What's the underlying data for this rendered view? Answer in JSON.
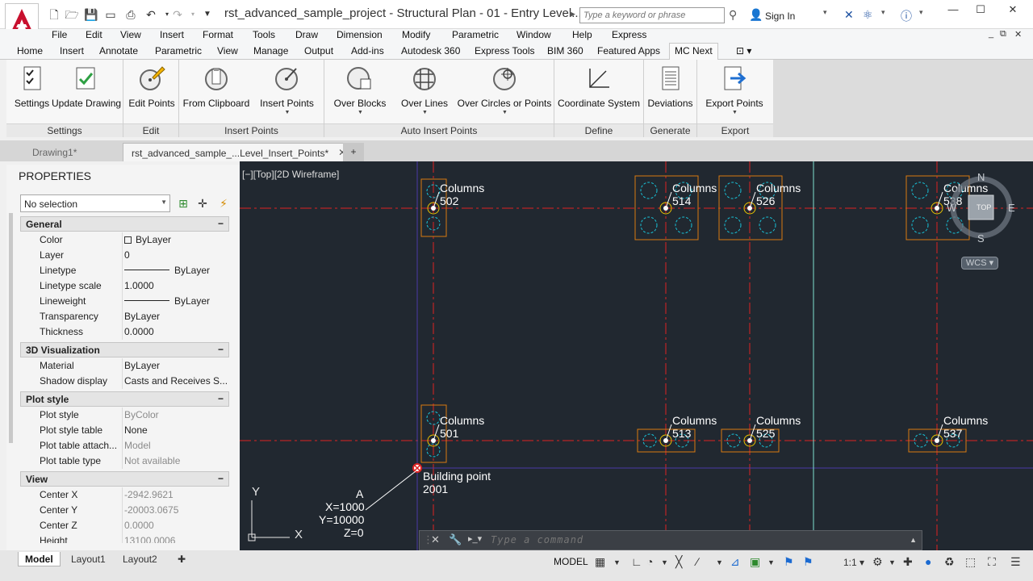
{
  "title_bar": {
    "window_title": "rst_advanced_sample_project - Structural Plan - 01 - Entry Level...",
    "search_placeholder": "Type a keyword or phrase",
    "sign_in": "Sign In"
  },
  "menu": [
    "File",
    "Edit",
    "View",
    "Insert",
    "Format",
    "Tools",
    "Draw",
    "Dimension",
    "Modify",
    "Parametric",
    "Window",
    "Help",
    "Express"
  ],
  "ribbon_tabs": [
    "Home",
    "Insert",
    "Annotate",
    "Parametric",
    "View",
    "Manage",
    "Output",
    "Add-ins",
    "Autodesk 360",
    "Express Tools",
    "BIM 360",
    "Featured Apps",
    "MC Next"
  ],
  "ribbon": {
    "buttons": {
      "settings": "Settings",
      "update_drawing": "Update Drawing",
      "edit_points": "Edit Points",
      "from_clipboard": "From Clipboard",
      "insert_points": "Insert Points",
      "over_blocks": "Over Blocks",
      "over_lines": "Over Lines",
      "over_circles": "Over Circles or Points",
      "coordinate_system": "Coordinate System",
      "deviations": "Deviations",
      "export_points": "Export Points"
    },
    "groups": {
      "settings": "Settings",
      "edit": "Edit",
      "insert_points": "Insert Points",
      "auto_insert": "Auto Insert Points",
      "define": "Define",
      "generate": "Generate",
      "export": "Export"
    }
  },
  "doc_tabs": [
    "Drawing1*",
    "rst_advanced_sample_...Level_Insert_Points*"
  ],
  "properties": {
    "title": "PROPERTIES",
    "selection": "No selection",
    "categories": {
      "general": {
        "label": "General",
        "rows": [
          {
            "k": "Color",
            "v": "ByLayer"
          },
          {
            "k": "Layer",
            "v": "0"
          },
          {
            "k": "Linetype",
            "v": "ByLayer"
          },
          {
            "k": "Linetype scale",
            "v": "1.0000"
          },
          {
            "k": "Lineweight",
            "v": "ByLayer"
          },
          {
            "k": "Transparency",
            "v": "ByLayer"
          },
          {
            "k": "Thickness",
            "v": "0.0000"
          }
        ]
      },
      "visual3d": {
        "label": "3D Visualization",
        "rows": [
          {
            "k": "Material",
            "v": "ByLayer"
          },
          {
            "k": "Shadow display",
            "v": "Casts and Receives S..."
          }
        ]
      },
      "plot": {
        "label": "Plot style",
        "rows": [
          {
            "k": "Plot style",
            "v": "ByColor"
          },
          {
            "k": "Plot style table",
            "v": "None"
          },
          {
            "k": "Plot table attach...",
            "v": "Model"
          },
          {
            "k": "Plot table type",
            "v": "Not available"
          }
        ]
      },
      "view": {
        "label": "View",
        "rows": [
          {
            "k": "Center X",
            "v": "-2942.9621"
          },
          {
            "k": "Center Y",
            "v": "-20003.0675"
          },
          {
            "k": "Center Z",
            "v": "0.0000"
          },
          {
            "k": "Height",
            "v": "13100.0006"
          }
        ]
      }
    },
    "toggle_symbol": "−"
  },
  "layout_tabs": [
    "Model",
    "Layout1",
    "Layout2"
  ],
  "drawing": {
    "view_label": "[−][Top][2D Wireframe]",
    "columns": [
      {
        "label": "Columns",
        "num": "502"
      },
      {
        "label": "Columns",
        "num": "514"
      },
      {
        "label": "Columns",
        "num": "526"
      },
      {
        "label": "Columns",
        "num": "538"
      },
      {
        "label": "Columns",
        "num": "501"
      },
      {
        "label": "Columns",
        "num": "513"
      },
      {
        "label": "Columns",
        "num": "525"
      },
      {
        "label": "Columns",
        "num": "537"
      }
    ],
    "building_point": {
      "label": "Building point",
      "num": "2001"
    },
    "coord_label": {
      "name": "A",
      "x": "X=1000",
      "y": "Y=10000",
      "z": "Z=0"
    },
    "ucs": {
      "x": "X",
      "y": "Y"
    },
    "viewcube": {
      "n": "N",
      "s": "S",
      "e": "E",
      "w": "W",
      "top": "TOP",
      "wcs": "WCS"
    },
    "command_placeholder": "Type a command"
  },
  "status": {
    "model": "MODEL",
    "scale": "1:1"
  }
}
